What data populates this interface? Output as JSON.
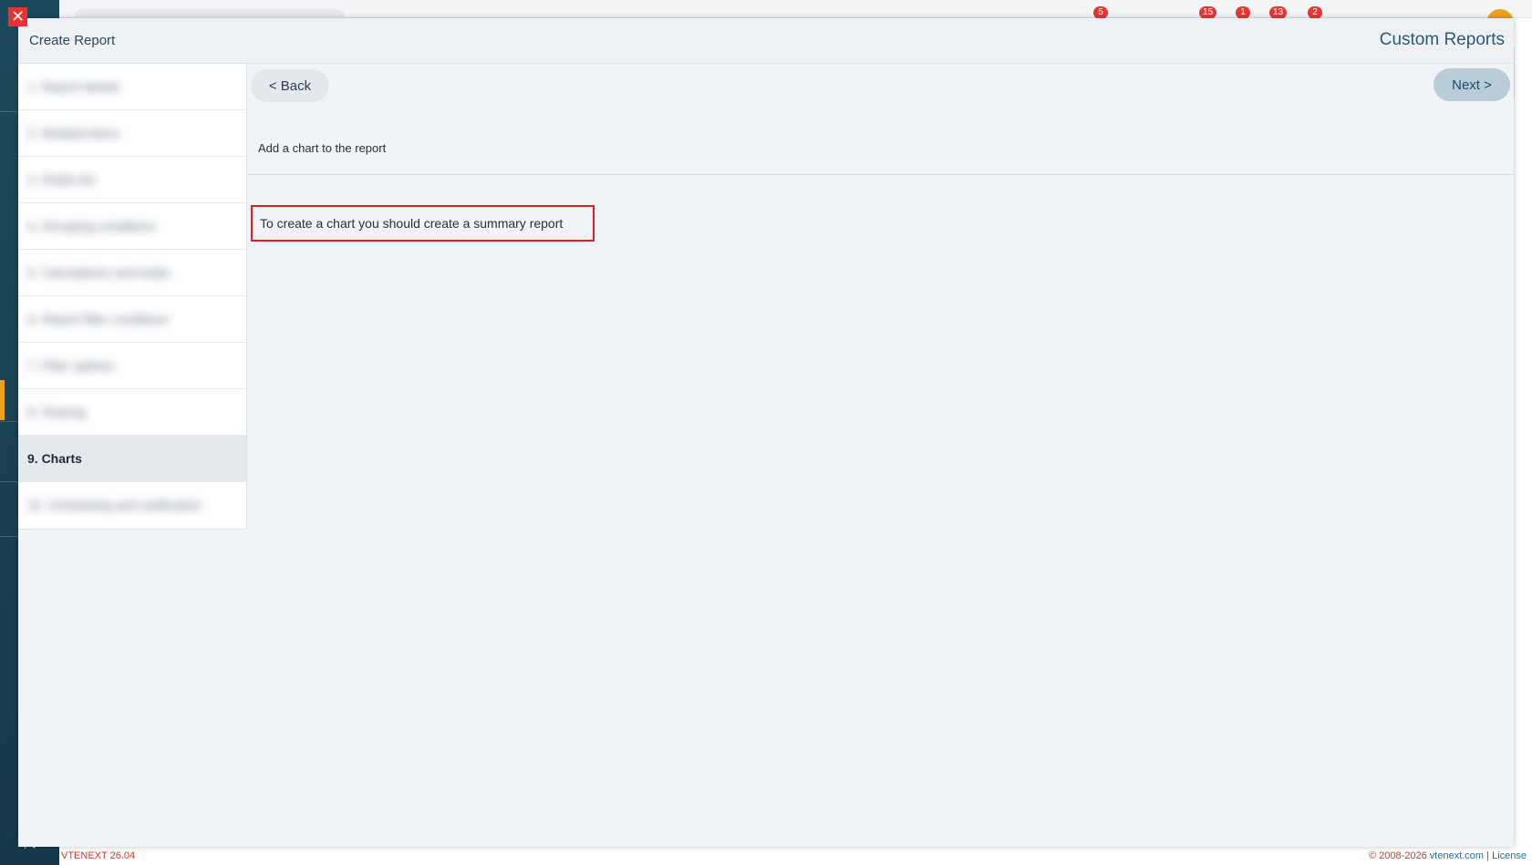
{
  "background": {
    "badges": [
      "5",
      "15",
      "1",
      "13",
      "2"
    ],
    "footer_version": "VTENEXT 26.04",
    "footer_copyright": "© 2008-2026",
    "footer_domain": "vtenext.com",
    "footer_license": "License"
  },
  "modal": {
    "title": "Create Report",
    "module_name": "Custom Reports",
    "close_glyph": "✕"
  },
  "steps": [
    {
      "label": "1. Report details",
      "active": false
    },
    {
      "label": "2. Related items",
      "active": false
    },
    {
      "label": "3. Fields list",
      "active": false
    },
    {
      "label": "4. Grouping conditions",
      "active": false
    },
    {
      "label": "5. Calculations and totals",
      "active": false
    },
    {
      "label": "6. Report filter conditions",
      "active": false
    },
    {
      "label": "7. Filter options",
      "active": false
    },
    {
      "label": "8. Sharing",
      "active": false
    },
    {
      "label": "9. Charts",
      "active": true
    },
    {
      "label": "10. Scheduling and notification",
      "active": false
    }
  ],
  "toolbar": {
    "back_label": "< Back",
    "next_label": "Next >"
  },
  "content": {
    "section_title": "Add a chart to the report",
    "notice": "To create a chart you should create a summary report"
  }
}
